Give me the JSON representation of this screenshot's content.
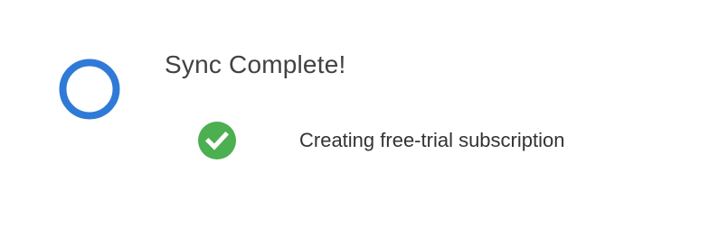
{
  "sync": {
    "title": "Sync Complete!",
    "ring_color": "#2f7ad6",
    "steps": [
      {
        "label": "Creating free-trial subscription",
        "status_icon": "check-circle-icon",
        "status_color": "#4caf50"
      }
    ]
  }
}
